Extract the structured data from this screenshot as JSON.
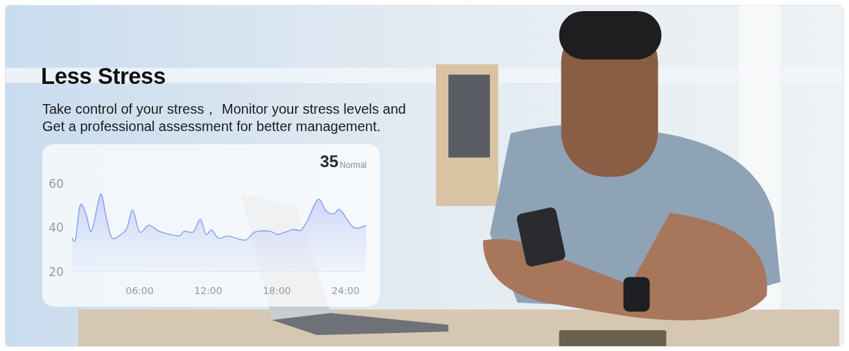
{
  "banner": {
    "title": "Less Stress",
    "description": "Take control of your stress， Monitor your stress levels and Get a professional assessment for better management.",
    "stress_card": {
      "value": "35",
      "status": "Normal",
      "chart_data": {
        "type": "area",
        "x": [
          0.1,
          0.4,
          0.8,
          1.3,
          1.7,
          2.0,
          2.6,
          3.1,
          3.6,
          4.5,
          4.9,
          5.4,
          6.0,
          6.8,
          7.7,
          8.6,
          9.5,
          9.9,
          10.7,
          11.3,
          11.8,
          12.3,
          12.9,
          13.8,
          15.2,
          16.1,
          17.4,
          18.1,
          19.4,
          20.1,
          20.7,
          21.6,
          22.3,
          23.0,
          23.5,
          24.5,
          25.0,
          25.8
        ],
        "series": [
          {
            "color": "#7f9ff0",
            "values": [
              35.2,
              34.6,
              50.1,
              46.4,
              38.5,
              41.9,
              55.2,
              44.2,
              35.2,
              37.4,
              39.7,
              47.8,
              38.0,
              41.0,
              38.3,
              36.9,
              36.3,
              38.3,
              38.0,
              43.7,
              36.9,
              38.9,
              35.2,
              36.1,
              34.3,
              38.0,
              38.3,
              36.9,
              39.1,
              38.8,
              43.6,
              52.8,
              47.5,
              46.2,
              48.1,
              41.0,
              39.7,
              41.0
            ]
          }
        ],
        "xlim": [
          0.1,
          25.8
        ],
        "ylim": [
          20,
          60
        ],
        "xticks": [
          {
            "value": 6,
            "label": "06:00"
          },
          {
            "value": 12,
            "label": "12:00"
          },
          {
            "value": 18,
            "label": "18:00"
          },
          {
            "value": 24,
            "label": "24:00"
          }
        ],
        "yticks": [
          20,
          40,
          60
        ]
      }
    }
  }
}
